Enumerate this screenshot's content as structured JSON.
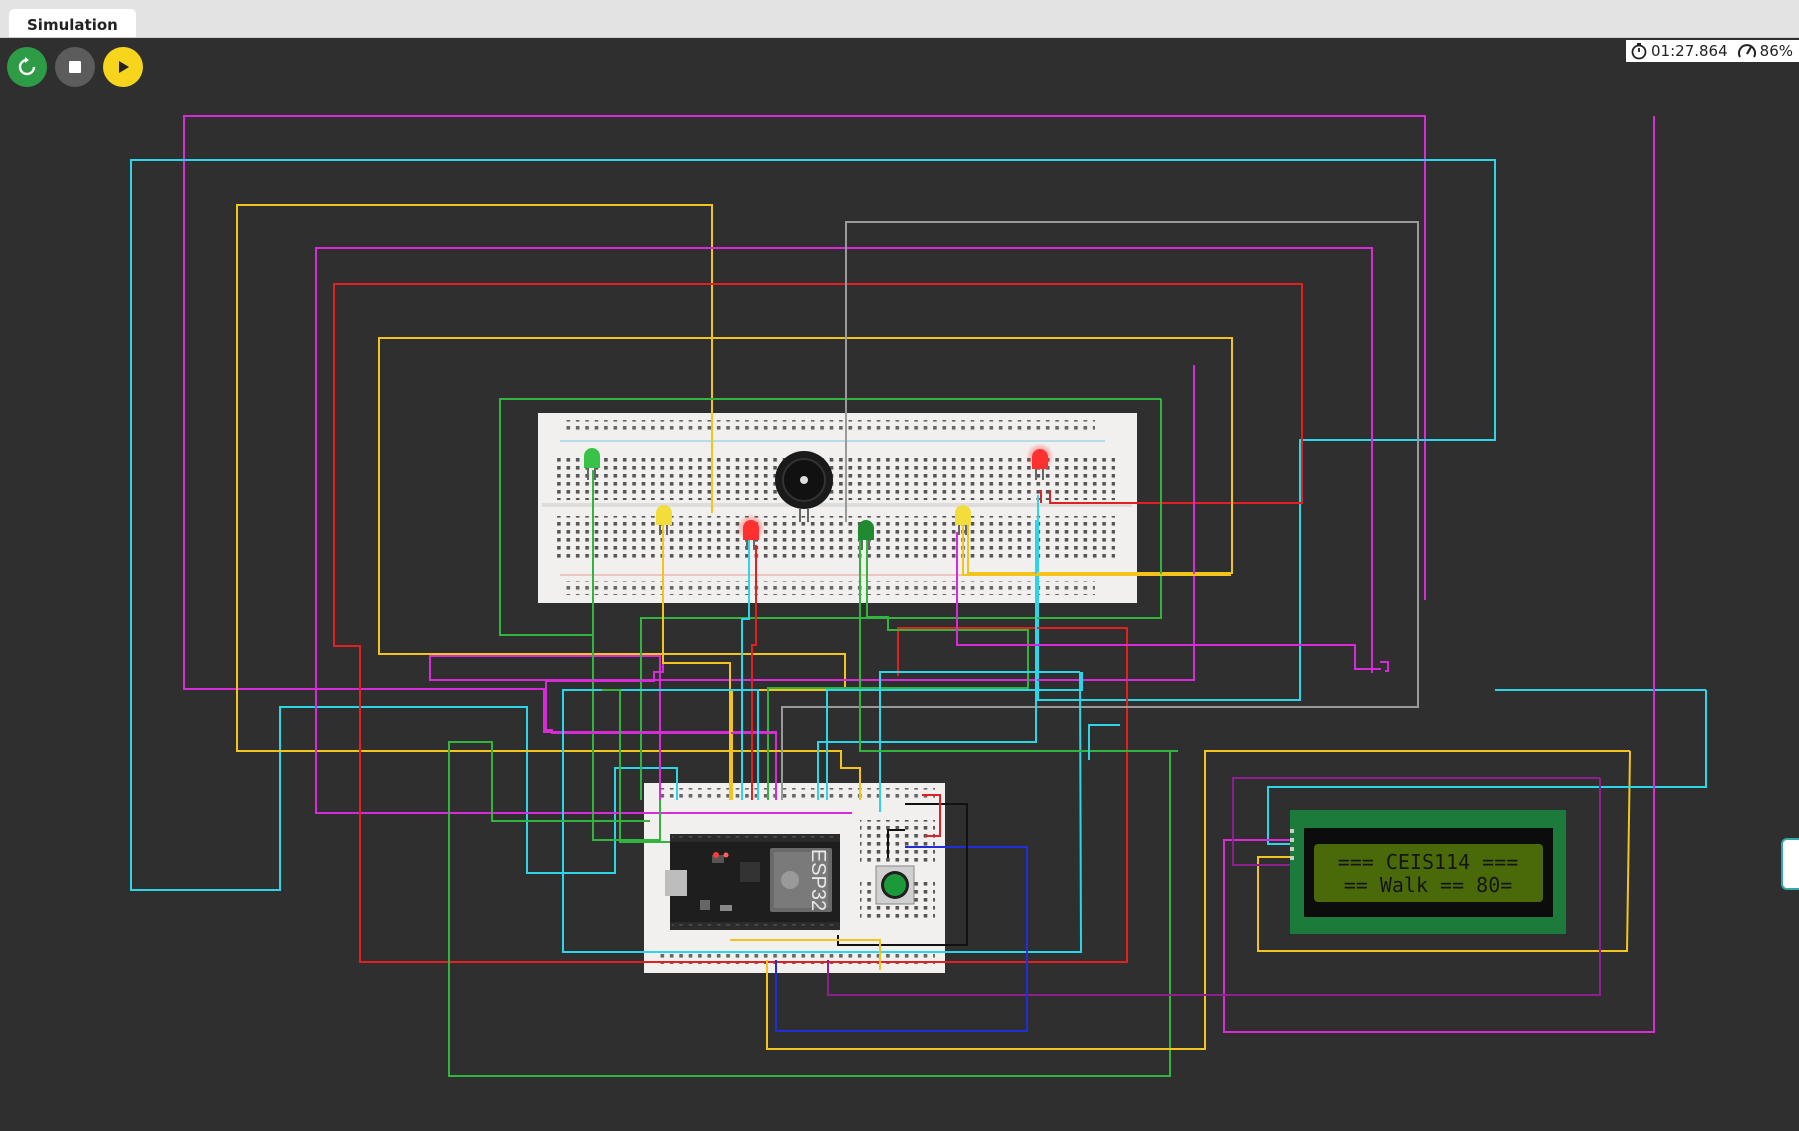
{
  "tabs": [
    {
      "label": "Simulation",
      "active": true
    }
  ],
  "toolbar": {
    "restart_icon": "restart-icon",
    "stop_icon": "stop-icon",
    "play_icon": "play-icon"
  },
  "status": {
    "time": "01:27.864",
    "speed": "86%",
    "time_icon": "stopwatch-icon",
    "speed_icon": "speedometer-icon"
  },
  "chip": {
    "label": "ESP32"
  },
  "lcd": {
    "line1": "=== CEIS114 ===",
    "line2": "== Walk ==  80="
  },
  "components": {
    "leds": [
      {
        "color": "green",
        "lit": false
      },
      {
        "color": "yellow",
        "lit": false
      },
      {
        "color": "red",
        "lit": true
      },
      {
        "color": "green",
        "lit": false
      },
      {
        "color": "yellow",
        "lit": false
      },
      {
        "color": "red",
        "lit": true
      }
    ],
    "buzzer": "buzzer",
    "button_color": "green"
  },
  "colors": {
    "background": "#2f2f2f",
    "tabbar": "#e3e3e3",
    "restart": "#2e9c46",
    "stop": "#5c5c5c",
    "play": "#f7d51d",
    "lcd_board": "#1c7a3a",
    "lcd_screen": "#4a6a0a",
    "wire_cyan": "#2cd6e8",
    "wire_magenta": "#d62bd6",
    "wire_yellow": "#f2c41c",
    "wire_red": "#e22020",
    "wire_green": "#31b53e",
    "wire_gray": "#9a9a9a",
    "wire_blue": "#1f2ed8",
    "wire_black": "#111111"
  }
}
